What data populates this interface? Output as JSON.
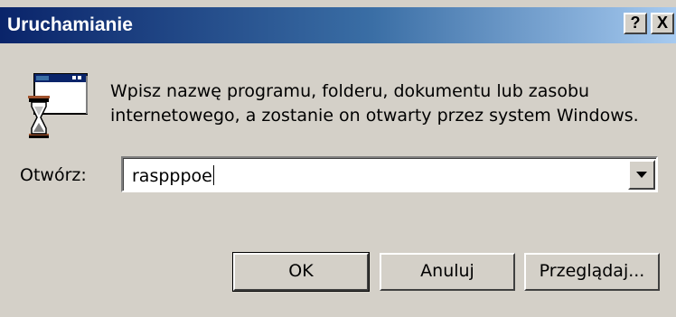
{
  "window": {
    "title": "Uruchamianie",
    "help_label": "?",
    "close_label": "X"
  },
  "content": {
    "description_line1": "Wpisz nazwę programu, folderu, dokumentu lub zasobu",
    "description_line2": "internetowego, a zostanie on otwarty przez system Windows.",
    "icon": "run-dialog-icon"
  },
  "open_field": {
    "label": "Otwórz:",
    "value": "raspppoe"
  },
  "buttons": {
    "ok": "OK",
    "cancel": "Anuluj",
    "browse": "Przeglądaj..."
  },
  "colors": {
    "titlebar_start": "#0a246a",
    "titlebar_end": "#a6caf0",
    "face": "#d4d0c8"
  }
}
